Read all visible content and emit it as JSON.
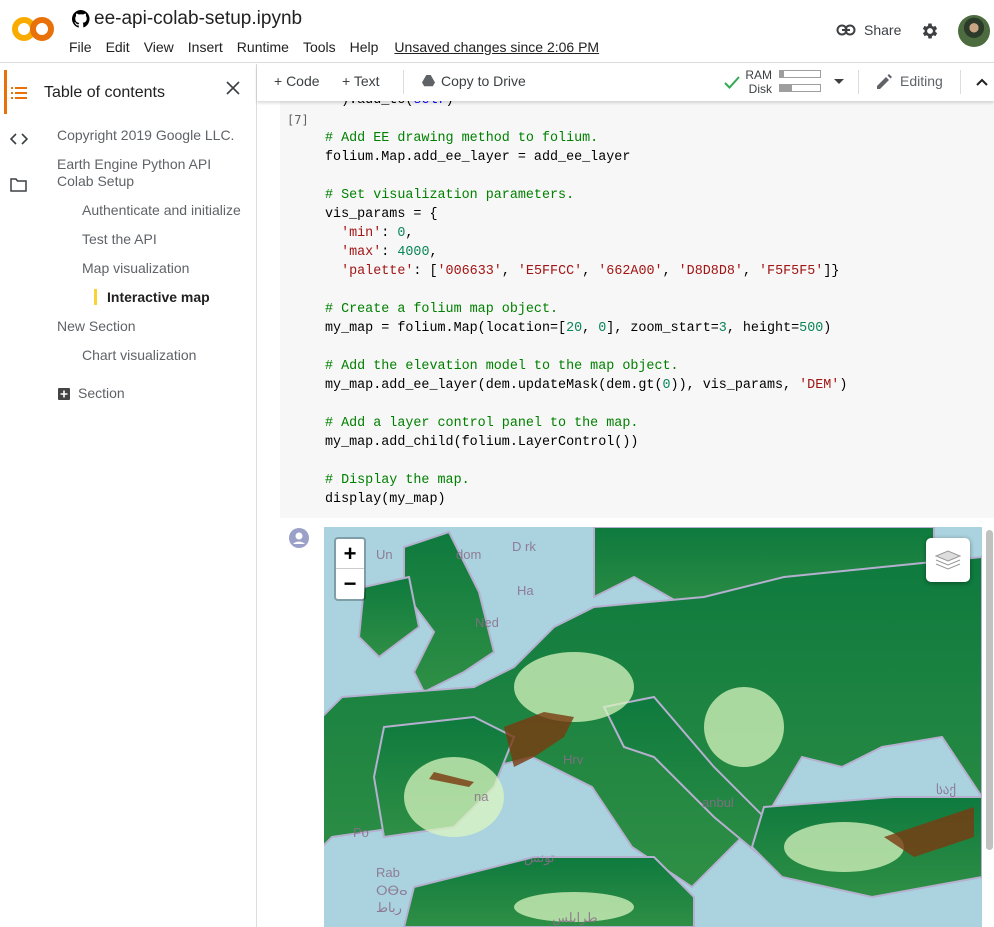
{
  "header": {
    "title": "ee-api-colab-setup.ipynb",
    "menu": [
      "File",
      "Edit",
      "View",
      "Insert",
      "Runtime",
      "Tools",
      "Help"
    ],
    "unsaved": "Unsaved changes since 2:06 PM",
    "share": "Share",
    "logo_text": "CO"
  },
  "toolbar": {
    "code": "+ Code",
    "text": "+ Text",
    "copy": "Copy to Drive",
    "ram": "RAM",
    "disk": "Disk",
    "ram_usage": 0.1,
    "disk_usage": 0.3,
    "editing": "Editing"
  },
  "sidebar": {
    "title": "Table of contents",
    "items": [
      {
        "label": "Copyright 2019 Google LLC.",
        "level": 1
      },
      {
        "label": "Earth Engine Python API Colab Setup",
        "level": 1
      },
      {
        "label": "Authenticate and initialize",
        "level": 2
      },
      {
        "label": "Test the API",
        "level": 2
      },
      {
        "label": "Map visualization",
        "level": 2
      },
      {
        "label": "Interactive map",
        "level": 3,
        "active": true
      },
      {
        "label": "New Section",
        "level": 1
      },
      {
        "label": "Chart visualization",
        "level": 2
      }
    ],
    "add_section": "Section"
  },
  "cell": {
    "exec_count": "[7]",
    "lines": [
      [
        [
          "p",
          "  ).add_to("
        ],
        [
          "k",
          "self"
        ],
        [
          "p",
          ")"
        ]
      ],
      [],
      [
        [
          "c",
          "# Add EE drawing method to folium."
        ]
      ],
      [
        [
          "p",
          "folium.Map.add_ee_layer = add_ee_layer"
        ]
      ],
      [],
      [
        [
          "c",
          "# Set visualization parameters."
        ]
      ],
      [
        [
          "p",
          "vis_params = {"
        ]
      ],
      [
        [
          "p",
          "  "
        ],
        [
          "s",
          "'min'"
        ],
        [
          "p",
          ": "
        ],
        [
          "n",
          "0"
        ],
        [
          "p",
          ","
        ]
      ],
      [
        [
          "p",
          "  "
        ],
        [
          "s",
          "'max'"
        ],
        [
          "p",
          ": "
        ],
        [
          "n",
          "4000"
        ],
        [
          "p",
          ","
        ]
      ],
      [
        [
          "p",
          "  "
        ],
        [
          "s",
          "'palette'"
        ],
        [
          "p",
          ": ["
        ],
        [
          "s",
          "'006633'"
        ],
        [
          "p",
          ", "
        ],
        [
          "s",
          "'E5FFCC'"
        ],
        [
          "p",
          ", "
        ],
        [
          "s",
          "'662A00'"
        ],
        [
          "p",
          ", "
        ],
        [
          "s",
          "'D8D8D8'"
        ],
        [
          "p",
          ", "
        ],
        [
          "s",
          "'F5F5F5'"
        ],
        [
          "p",
          "]}"
        ]
      ],
      [],
      [
        [
          "c",
          "# Create a folium map object."
        ]
      ],
      [
        [
          "p",
          "my_map = folium.Map(location=["
        ],
        [
          "n",
          "20"
        ],
        [
          "p",
          ", "
        ],
        [
          "n",
          "0"
        ],
        [
          "p",
          "], zoom_start="
        ],
        [
          "n",
          "3"
        ],
        [
          "p",
          ", height="
        ],
        [
          "n",
          "500"
        ],
        [
          "p",
          ")"
        ]
      ],
      [],
      [
        [
          "c",
          "# Add the elevation model to the map object."
        ]
      ],
      [
        [
          "p",
          "my_map.add_ee_layer(dem.updateMask(dem.gt("
        ],
        [
          "n",
          "0"
        ],
        [
          "p",
          ")), vis_params, "
        ],
        [
          "s",
          "'DEM'"
        ],
        [
          "p",
          ")"
        ]
      ],
      [],
      [
        [
          "c",
          "# Add a layer control panel to the map."
        ]
      ],
      [
        [
          "p",
          "my_map.add_child(folium.LayerControl())"
        ]
      ],
      [],
      [
        [
          "c",
          "# Display the map."
        ]
      ],
      [
        [
          "p",
          "display(my_map)"
        ]
      ]
    ]
  },
  "map": {
    "zoom_in": "+",
    "zoom_out": "−",
    "labels": [
      "Un",
      "dom",
      "Ned",
      "Hrv",
      "na",
      "anbul",
      "Po",
      "Rab",
      "ⵔⴱⴰ",
      "رباط",
      "تونس",
      "طرابلس",
      "საქ",
      "Ha",
      "D   rk"
    ],
    "palette": [
      "#006633",
      "#E5FFCC",
      "#662A00",
      "#D8D8D8",
      "#F5F5F5"
    ]
  }
}
